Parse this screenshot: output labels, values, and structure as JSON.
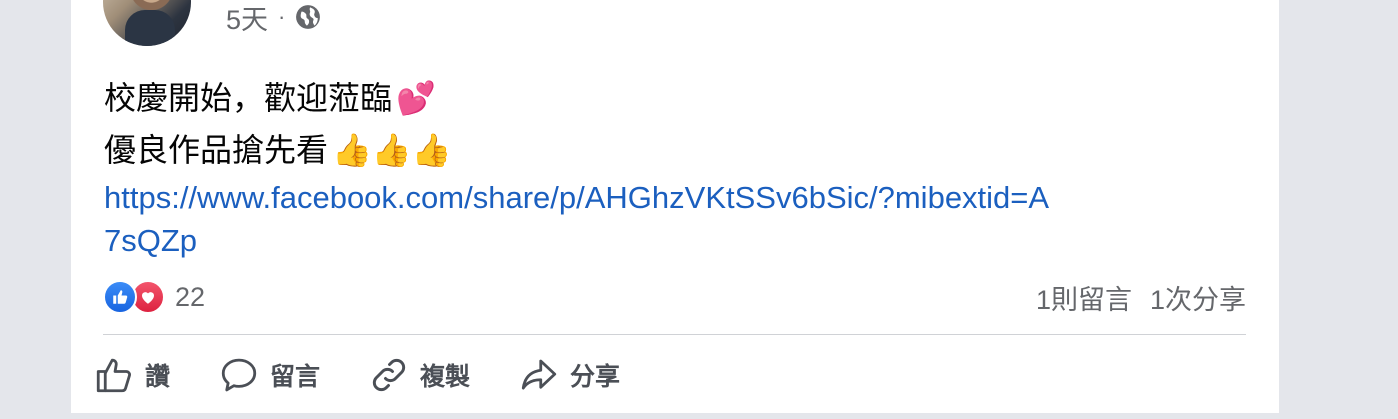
{
  "post": {
    "time": "5天",
    "separator": "·",
    "privacy_icon": "globe-icon",
    "text_line1": "校慶開始，歡迎蒞臨",
    "text_line1_emoji": "💕",
    "text_line2": "優良作品搶先看",
    "text_line2_emoji": "👍👍👍",
    "link": "https://www.facebook.com/share/p/AHGhzVKtSSv6bSic/?mibextid=A7sQZp"
  },
  "reactions": {
    "count": "22",
    "types": [
      "like",
      "love"
    ],
    "comments": "1則留言",
    "shares": "1次分享"
  },
  "actions": {
    "like": "讚",
    "comment": "留言",
    "copy": "複製",
    "share": "分享"
  },
  "colors": {
    "link": "#1b5fbf",
    "secondary_text": "#65676b",
    "like_blue": "#1864e0",
    "love_red": "#dd2240"
  }
}
